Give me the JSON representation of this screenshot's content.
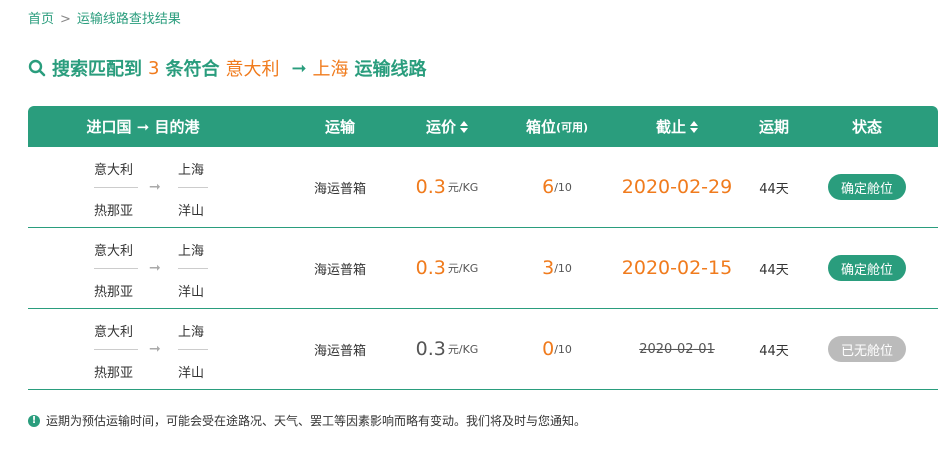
{
  "breadcrumb": {
    "home": "首页",
    "current": "运输线路查找结果",
    "sep": ">"
  },
  "headline": {
    "prefix": "搜索匹配到",
    "count": "3",
    "middle": "条符合",
    "origin": "意大利",
    "arrow": "➞",
    "destination": "上海",
    "suffix": "运输线路"
  },
  "table": {
    "headers": {
      "route": "进口国 ➞ 目的港",
      "transport": "运输",
      "price": "运价",
      "slots": "箱位",
      "slots_note": "(可用)",
      "deadline": "截止",
      "transit": "运期",
      "status": "状态"
    },
    "rows": [
      {
        "origin_country": "意大利",
        "origin_port": "热那亚",
        "dest_city": "上海",
        "dest_port": "洋山",
        "transport": "海运普箱",
        "price": "0.3",
        "price_unit": "元/KG",
        "slots": "6",
        "slots_total": "/10",
        "deadline": "2020-02-29",
        "transit": "44天",
        "status": "确定舱位",
        "available": true
      },
      {
        "origin_country": "意大利",
        "origin_port": "热那亚",
        "dest_city": "上海",
        "dest_port": "洋山",
        "transport": "海运普箱",
        "price": "0.3",
        "price_unit": "元/KG",
        "slots": "3",
        "slots_total": "/10",
        "deadline": "2020-02-15",
        "transit": "44天",
        "status": "确定舱位",
        "available": true
      },
      {
        "origin_country": "意大利",
        "origin_port": "热那亚",
        "dest_city": "上海",
        "dest_port": "洋山",
        "transport": "海运普箱",
        "price": "0.3",
        "price_unit": "元/KG",
        "slots": "0",
        "slots_total": "/10",
        "deadline": "2020-02-01",
        "transit": "44天",
        "status": "已无舱位",
        "available": false
      }
    ]
  },
  "footnote": "运期为预估运输时间，可能会受在途路况、天气、罢工等因素影响而略有变动。我们将及时与您通知。",
  "colors": {
    "accent": "#2a9d7d",
    "highlight": "#f07b1d",
    "disabled": "#bbbbbb"
  }
}
